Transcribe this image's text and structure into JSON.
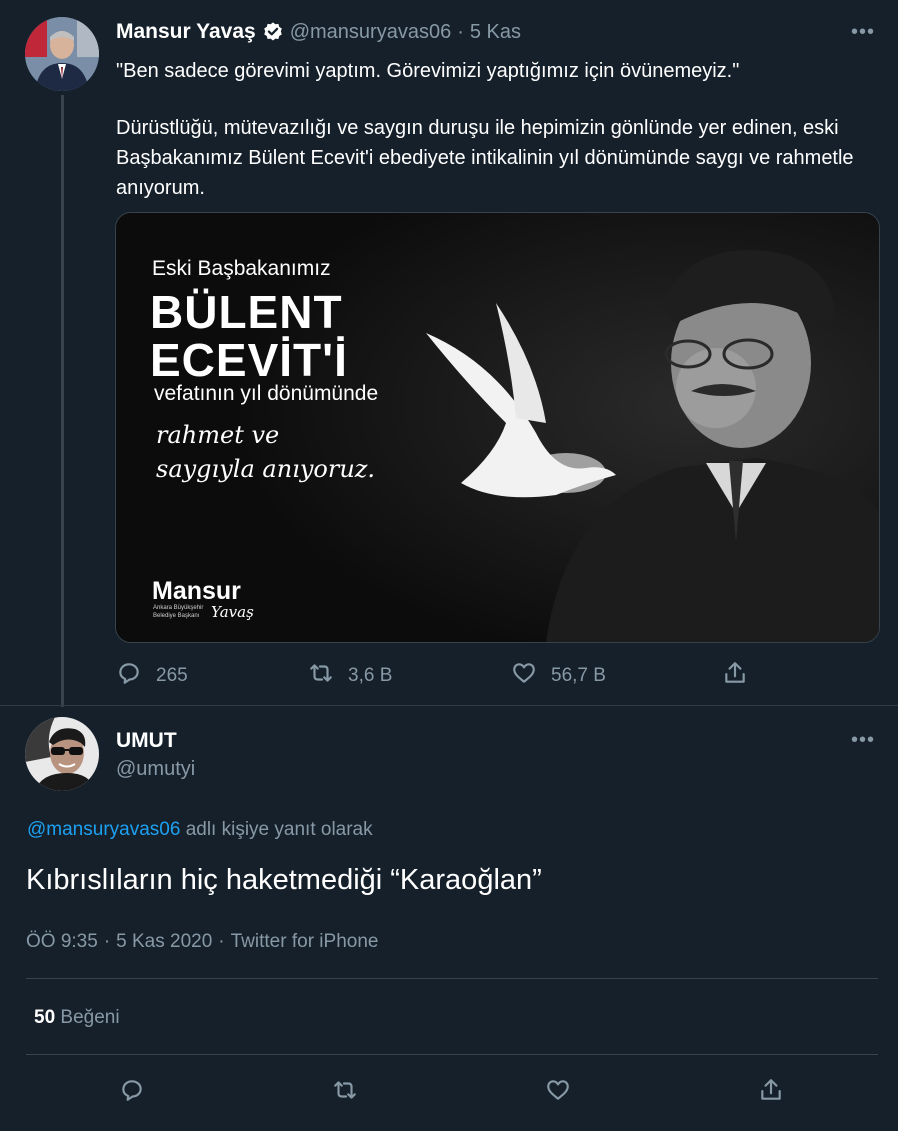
{
  "tweet1": {
    "author": "Mansur Yavaş",
    "handle": "@mansuryavas06",
    "separator": "·",
    "date": "5 Kas",
    "more": "•••",
    "text_p1": "\"Ben sadece görevimi yaptım. Görevimizi yaptığımız için övünemeyiz.\"",
    "text_p2": "Dürüstlüğü, mütevazılığı ve saygın duruşu ile hepimizin gönlünde yer edinen, eski Başbakanımız Bülent Ecevit'i ebediyete intikalinin yıl dönümünde saygı ve rahmetle anıyorum.",
    "image": {
      "line1": "Eski Başbakanımız",
      "line2": "BÜLENT",
      "line3": "ECEVİT'İ",
      "line4": "vefatının yıl dönümünde",
      "script1": "rahmet ve",
      "script2": "saygıyla anıyoruz.",
      "logo": "Mansur",
      "logo_sub1": "Ankara Büyükşehir",
      "logo_sub2": "Belediye Başkanı",
      "logo_script": "Yavaş"
    },
    "replies": "265",
    "retweets": "3,6 B",
    "likes": "56,7 B"
  },
  "tweet2": {
    "author": "UMUT",
    "handle": "@umutyi",
    "more": "•••",
    "reply_to_handle": "@mansuryavas06",
    "reply_to_suffix": "adlı kişiye yanıt olarak",
    "text": "Kıbrıslıların hiç haketmediği “Karaoğlan”",
    "time": "ÖÖ 9:35",
    "sep1": "·",
    "date": "5 Kas 2020",
    "sep2": "·",
    "source": "Twitter for iPhone",
    "like_count": "50",
    "like_label": "Beğeni"
  },
  "colors": {
    "background": "#15202b",
    "accent": "#1da1f2",
    "muted": "#8899a6",
    "divider": "#38444d"
  }
}
